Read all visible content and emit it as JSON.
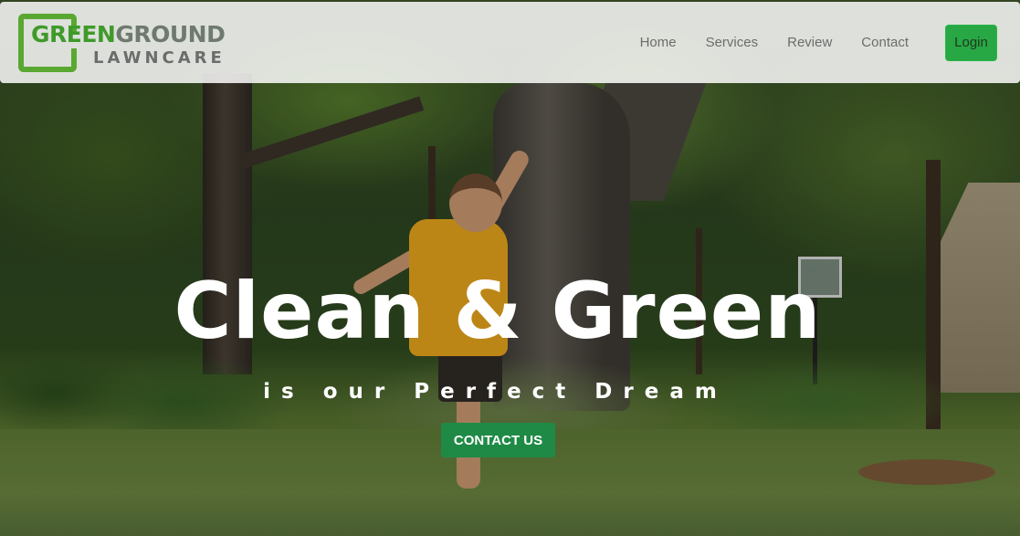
{
  "brand": {
    "name_part1": "GREEN",
    "name_part2": "GROUND",
    "tagline": "LAWNCARE",
    "colors": {
      "primary_green": "#3f9a2a",
      "gray": "#6f7a6f"
    }
  },
  "nav": {
    "links": [
      {
        "label": "Home"
      },
      {
        "label": "Services"
      },
      {
        "label": "Review"
      },
      {
        "label": "Contact"
      }
    ],
    "login_label": "Login",
    "login_color": "#28a745"
  },
  "hero": {
    "headline": "Clean & Green",
    "subheadline": "is our Perfect Dream",
    "cta_label": "CONTACT US",
    "cta_color": "#1f8a46",
    "background_image": "backyard-photo"
  }
}
